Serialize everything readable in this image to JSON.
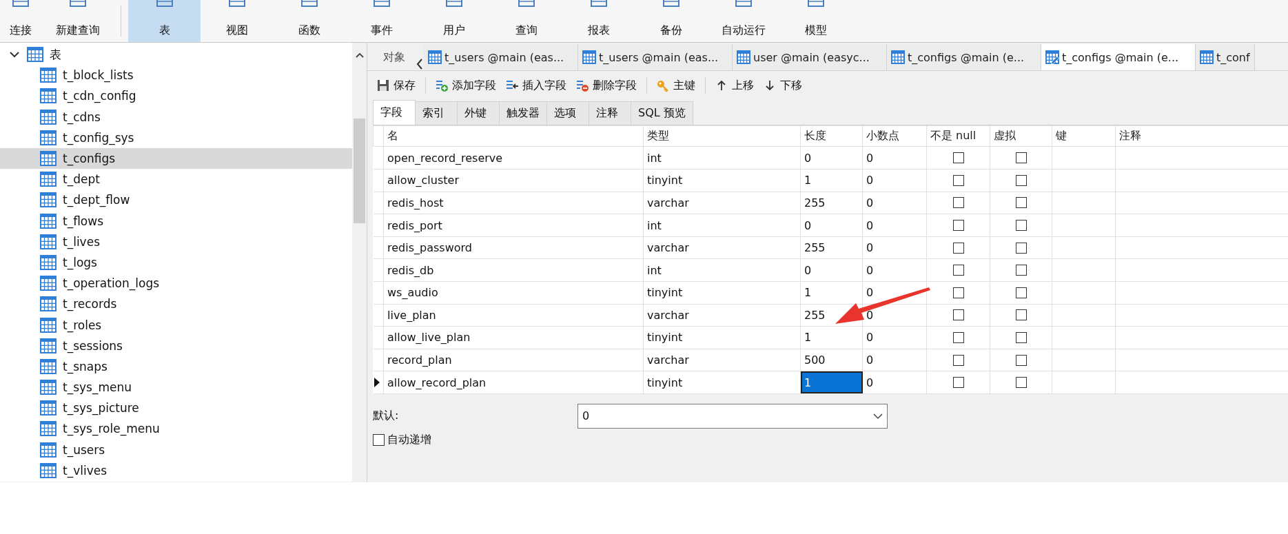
{
  "toolbar": [
    {
      "label": "连接",
      "selected": false
    },
    {
      "label": "新建查询",
      "selected": false
    },
    {
      "label": "表",
      "selected": true
    },
    {
      "label": "视图",
      "selected": false
    },
    {
      "label": "函数",
      "selected": false
    },
    {
      "label": "事件",
      "selected": false
    },
    {
      "label": "用户",
      "selected": false
    },
    {
      "label": "查询",
      "selected": false
    },
    {
      "label": "报表",
      "selected": false
    },
    {
      "label": "备份",
      "selected": false
    },
    {
      "label": "自动运行",
      "selected": false
    },
    {
      "label": "模型",
      "selected": false
    }
  ],
  "tree": {
    "label": "表",
    "expanded": true,
    "children": [
      {
        "label": "t_block_lists",
        "selected": false
      },
      {
        "label": "t_cdn_config",
        "selected": false
      },
      {
        "label": "t_cdns",
        "selected": false
      },
      {
        "label": "t_config_sys",
        "selected": false
      },
      {
        "label": "t_configs",
        "selected": true
      },
      {
        "label": "t_dept",
        "selected": false
      },
      {
        "label": "t_dept_flow",
        "selected": false
      },
      {
        "label": "t_flows",
        "selected": false
      },
      {
        "label": "t_lives",
        "selected": false
      },
      {
        "label": "t_logs",
        "selected": false
      },
      {
        "label": "t_operation_logs",
        "selected": false
      },
      {
        "label": "t_records",
        "selected": false
      },
      {
        "label": "t_roles",
        "selected": false
      },
      {
        "label": "t_sessions",
        "selected": false
      },
      {
        "label": "t_snaps",
        "selected": false
      },
      {
        "label": "t_sys_menu",
        "selected": false
      },
      {
        "label": "t_sys_picture",
        "selected": false
      },
      {
        "label": "t_sys_role_menu",
        "selected": false
      },
      {
        "label": "t_users",
        "selected": false
      },
      {
        "label": "t_vlives",
        "selected": false
      }
    ]
  },
  "document_tabs": {
    "object_tab": "对象",
    "tabs": [
      {
        "label": "t_users @main (eas...",
        "kind": "table",
        "selected": false
      },
      {
        "label": "t_users @main (eas...",
        "kind": "table",
        "selected": false
      },
      {
        "label": "user @main (easyc...",
        "kind": "table",
        "selected": false
      },
      {
        "label": "t_configs @main (e...",
        "kind": "table",
        "selected": false
      },
      {
        "label": "t_configs @main (e...",
        "kind": "design",
        "selected": true
      },
      {
        "label": "t_conf",
        "kind": "table",
        "selected": false
      }
    ]
  },
  "editor_toolbar": [
    {
      "label": "保存",
      "kind": "save"
    },
    {
      "label": "添加字段",
      "kind": "add"
    },
    {
      "label": "插入字段",
      "kind": "insert"
    },
    {
      "label": "删除字段",
      "kind": "delete"
    },
    {
      "label": "主键",
      "kind": "key"
    },
    {
      "label": "上移",
      "kind": "up"
    },
    {
      "label": "下移",
      "kind": "down"
    }
  ],
  "sub_tabs": [
    {
      "label": "字段",
      "selected": true
    },
    {
      "label": "索引",
      "selected": false
    },
    {
      "label": "外键",
      "selected": false
    },
    {
      "label": "触发器",
      "selected": false
    },
    {
      "label": "选项",
      "selected": false
    },
    {
      "label": "注释",
      "selected": false
    },
    {
      "label": "SQL 预览",
      "selected": false
    }
  ],
  "fields_table": {
    "columns": [
      "名",
      "类型",
      "长度",
      "小数点",
      "不是 null",
      "虚拟",
      "键",
      "注释"
    ],
    "rows": [
      {
        "name": "open_record_reserve",
        "type": "int",
        "length": "0",
        "decimals": "0",
        "not_null": false,
        "virtual": false,
        "current": false,
        "length_selected": false
      },
      {
        "name": "allow_cluster",
        "type": "tinyint",
        "length": "1",
        "decimals": "0",
        "not_null": false,
        "virtual": false,
        "current": false,
        "length_selected": false
      },
      {
        "name": "redis_host",
        "type": "varchar",
        "length": "255",
        "decimals": "0",
        "not_null": false,
        "virtual": false,
        "current": false,
        "length_selected": false
      },
      {
        "name": "redis_port",
        "type": "int",
        "length": "0",
        "decimals": "0",
        "not_null": false,
        "virtual": false,
        "current": false,
        "length_selected": false
      },
      {
        "name": "redis_password",
        "type": "varchar",
        "length": "255",
        "decimals": "0",
        "not_null": false,
        "virtual": false,
        "current": false,
        "length_selected": false
      },
      {
        "name": "redis_db",
        "type": "int",
        "length": "0",
        "decimals": "0",
        "not_null": false,
        "virtual": false,
        "current": false,
        "length_selected": false
      },
      {
        "name": "ws_audio",
        "type": "tinyint",
        "length": "1",
        "decimals": "0",
        "not_null": false,
        "virtual": false,
        "current": false,
        "length_selected": false
      },
      {
        "name": "live_plan",
        "type": "varchar",
        "length": "255",
        "decimals": "0",
        "not_null": false,
        "virtual": false,
        "current": false,
        "length_selected": false
      },
      {
        "name": "allow_live_plan",
        "type": "tinyint",
        "length": "1",
        "decimals": "0",
        "not_null": false,
        "virtual": false,
        "current": false,
        "length_selected": false
      },
      {
        "name": "record_plan",
        "type": "varchar",
        "length": "500",
        "decimals": "0",
        "not_null": false,
        "virtual": false,
        "current": false,
        "length_selected": false
      },
      {
        "name": "allow_record_plan",
        "type": "tinyint",
        "length": "1",
        "decimals": "0",
        "not_null": false,
        "virtual": false,
        "current": true,
        "length_selected": true
      }
    ]
  },
  "properties": {
    "default_label": "默认:",
    "default_value": "0",
    "options": [
      {
        "label": "自动递增",
        "checked": false
      }
    ]
  }
}
